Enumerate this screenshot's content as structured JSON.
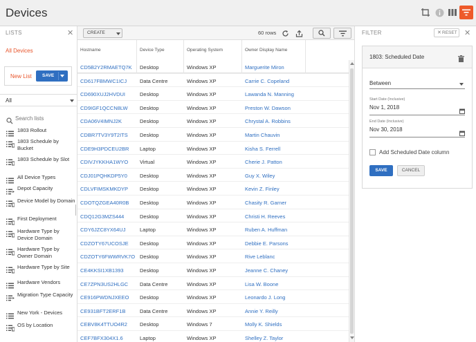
{
  "header": {
    "title": "Devices",
    "icons": [
      "crop-icon",
      "info-icon",
      "columns-icon",
      "filter-icon"
    ],
    "accent_color": "#ee5a2a"
  },
  "lists_panel": {
    "title": "LISTS",
    "all_devices": "All Devices",
    "new_list": "New List",
    "save_label": "SAVE",
    "filter_select": "All",
    "search_placeholder": "Search lists",
    "items": [
      {
        "label": "1803 Rollout",
        "icon": "list-icon"
      },
      {
        "label": "1803 Schedule by Bucket",
        "icon": "grouped-list-icon"
      },
      {
        "label": "1803 Schedule by Slot",
        "icon": "grouped-list-icon"
      },
      {
        "label": "All Device Types",
        "icon": "list-icon"
      },
      {
        "label": "Depot Capacity",
        "icon": "list-arrow-icon"
      },
      {
        "label": "Device Model by Domain",
        "icon": "grouped-list-icon"
      },
      {
        "label": "First Deployment",
        "icon": "grouped-list-icon"
      },
      {
        "label": "Hardware Type by Device Domain",
        "icon": "grouped-list-icon"
      },
      {
        "label": "Hardware Type by Owner Domain",
        "icon": "grouped-list-icon"
      },
      {
        "label": "Hardware Type by Site",
        "icon": "grouped-list-icon"
      },
      {
        "label": "Hardware Vendors",
        "icon": "list-icon"
      },
      {
        "label": "Migration Type Capacity",
        "icon": "list-arrow-icon"
      },
      {
        "label": "New York - Devices",
        "icon": "list-icon"
      },
      {
        "label": "OS by Location",
        "icon": "grouped-list-icon"
      }
    ]
  },
  "table": {
    "create_label": "CREATE",
    "row_count": "60 rows",
    "columns": [
      "Hostname",
      "Device Type",
      "Operating System",
      "Owner Display Name"
    ],
    "rows": [
      [
        "CD5B2Y2RMAETQ7K",
        "Desktop",
        "Windows XP",
        "Marguerite Miron"
      ],
      [
        "CD617FBMWC1ICJ",
        "Data Centre",
        "Windows XP",
        "Carrie C. Copeland"
      ],
      [
        "CD690XUJ2HVDUI",
        "Desktop",
        "Windows XP",
        "Lawanda N. Manning"
      ],
      [
        "CD9IGF1QCCN8LW",
        "Desktop",
        "Windows XP",
        "Preston W. Dawson"
      ],
      [
        "CDA06V4IMNJ2K",
        "Desktop",
        "Windows XP",
        "Chrystal A. Robbins"
      ],
      [
        "CDBR7TV3Y9T2ITS",
        "Desktop",
        "Windows XP",
        "Martin Chauvin"
      ],
      [
        "CDE9H3PDCEU2BR",
        "Laptop",
        "Windows XP",
        "Kisha S. Ferrell"
      ],
      [
        "CDIVJYKKHA1WYO",
        "Virtual",
        "Windows XP",
        "Cherie J. Patton"
      ],
      [
        "CDJ01PQHKDP5Y0",
        "Desktop",
        "Windows XP",
        "Guy X. Wiley"
      ],
      [
        "CDLVFIMSKMKDYP",
        "Desktop",
        "Windows XP",
        "Kevin Z. Finley"
      ],
      [
        "CDOTQZGEA40R0B",
        "Desktop",
        "Windows XP",
        "Chasity R. Garner"
      ],
      [
        "CDQ12G3MZS444",
        "Desktop",
        "Windows XP",
        "Christi H. Reeves"
      ],
      [
        "CDY6JZC8YX64UJ",
        "Laptop",
        "Windows XP",
        "Ruben A. Huffman"
      ],
      [
        "CDZOTY67UCOSJE",
        "Desktop",
        "Windows XP",
        "Debbie E. Parsons"
      ],
      [
        "CDZOTY6FWWRVK7O",
        "Desktop",
        "Windows XP",
        "Rive Leblanc"
      ],
      [
        "CE4KKSI1XB1393",
        "Desktop",
        "Windows XP",
        "Jeanne C. Chaney"
      ],
      [
        "CE7ZPN3US2HLGC",
        "Data Centre",
        "Windows XP",
        "Lisa W. Boone"
      ],
      [
        "CE916PWDNJXEEO",
        "Desktop",
        "Windows XP",
        "Leonardo J. Long"
      ],
      [
        "CE931BFT2ERF1B",
        "Data Centre",
        "Windows XP",
        "Annie Y. Reilly"
      ],
      [
        "CEBV8K4TTUO4R2",
        "Desktop",
        "Windows 7",
        "Molly K. Shields"
      ],
      [
        "CEF7BFX304X1.6",
        "Laptop",
        "Windows XP",
        "Shelley Z. Taylor"
      ]
    ]
  },
  "filter_panel": {
    "title": "FILTER",
    "reset_label": "RESET",
    "card_title": "1803: Scheduled Date",
    "operator": "Between",
    "start_label": "Start Date (Inclusive)",
    "start_value": "Nov 1, 2018",
    "end_label": "End Date (Inclusive)",
    "end_value": "Nov 30, 2018",
    "add_column_label": "Add Scheduled Date column",
    "save_label": "SAVE",
    "cancel_label": "CANCEL"
  }
}
